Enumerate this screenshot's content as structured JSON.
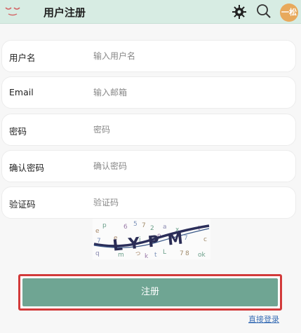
{
  "header": {
    "title": "用户注册",
    "avatar_text": "一松"
  },
  "form": {
    "fields": [
      {
        "label": "用户名",
        "placeholder": "输入用户名"
      },
      {
        "label": "Email",
        "placeholder": "输入邮箱"
      },
      {
        "label": "密码",
        "placeholder": "密码"
      },
      {
        "label": "确认密码",
        "placeholder": "确认密码"
      },
      {
        "label": "验证码",
        "placeholder": "验证码"
      }
    ]
  },
  "captcha": {
    "text": "LYPM"
  },
  "actions": {
    "submit_label": "注册",
    "login_link_label": "直接登录"
  },
  "colors": {
    "header_bg": "#d7ece3",
    "primary": "#6fa593",
    "highlight_border": "#d23a3a",
    "avatar": "#e8a95c"
  }
}
